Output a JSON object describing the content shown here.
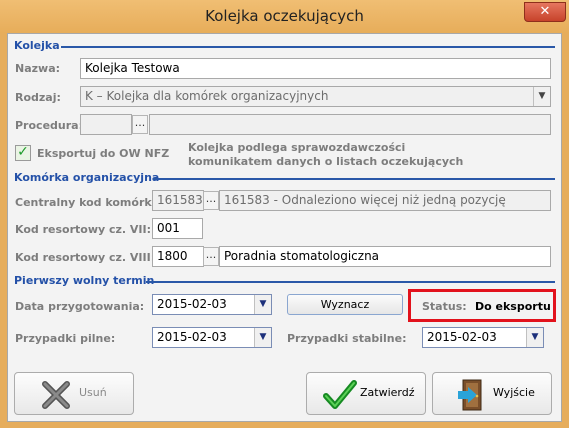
{
  "window": {
    "title": "Kolejka oczekujących",
    "close_label": "✕"
  },
  "section_queue": {
    "title": "Kolejka",
    "name_label": "Nazwa:",
    "name_value": "Kolejka Testowa",
    "type_label": "Rodzaj:",
    "type_value": "K – Kolejka dla komórek organizacyjnych",
    "procedure_label": "Procedura:",
    "procedure_value": "",
    "ellipsis": "...",
    "export_checkbox_label": "Eksportuj do OW NFZ",
    "reporting_note_line1": "Kolejka podlega sprawozdawczości",
    "reporting_note_line2": "komunikatem danych o listach oczekujących"
  },
  "section_unit": {
    "title": "Komórka organizacyjna",
    "central_code_label": "Centralny kod komórki:",
    "central_code_value": "161583",
    "central_code_desc": "161583 - Odnaleziono więcej niż jedną pozycję",
    "code7_label": "Kod resortowy cz. VII:",
    "code7_value": "001",
    "code8_label": "Kod resortowy cz. VIII:",
    "code8_value": "1800",
    "code8_desc": "Poradnia stomatologiczna"
  },
  "section_term": {
    "title": "Pierwszy wolny termin",
    "prep_date_label": "Data przygotowania:",
    "prep_date_value": "2015-02-03",
    "compute_button": "Wyznacz",
    "status_label": "Status:",
    "status_value": "Do eksportu",
    "urgent_label": "Przypadki pilne:",
    "urgent_value": "2015-02-03",
    "stable_label": "Przypadki stabilne:",
    "stable_value": "2015-02-03"
  },
  "buttons": {
    "delete": "Usuń",
    "confirm": "Zatwierdź",
    "exit": "Wyjście"
  },
  "colors": {
    "frame": "#e6ad5c",
    "section_title": "#2451a8",
    "status_highlight": "#e2121c",
    "check_green": "#1d9b2a"
  },
  "icons": {
    "delete": "x-icon",
    "confirm": "checkmark-icon",
    "exit": "exit-door-icon",
    "dropdown": "chevron-down-icon"
  }
}
